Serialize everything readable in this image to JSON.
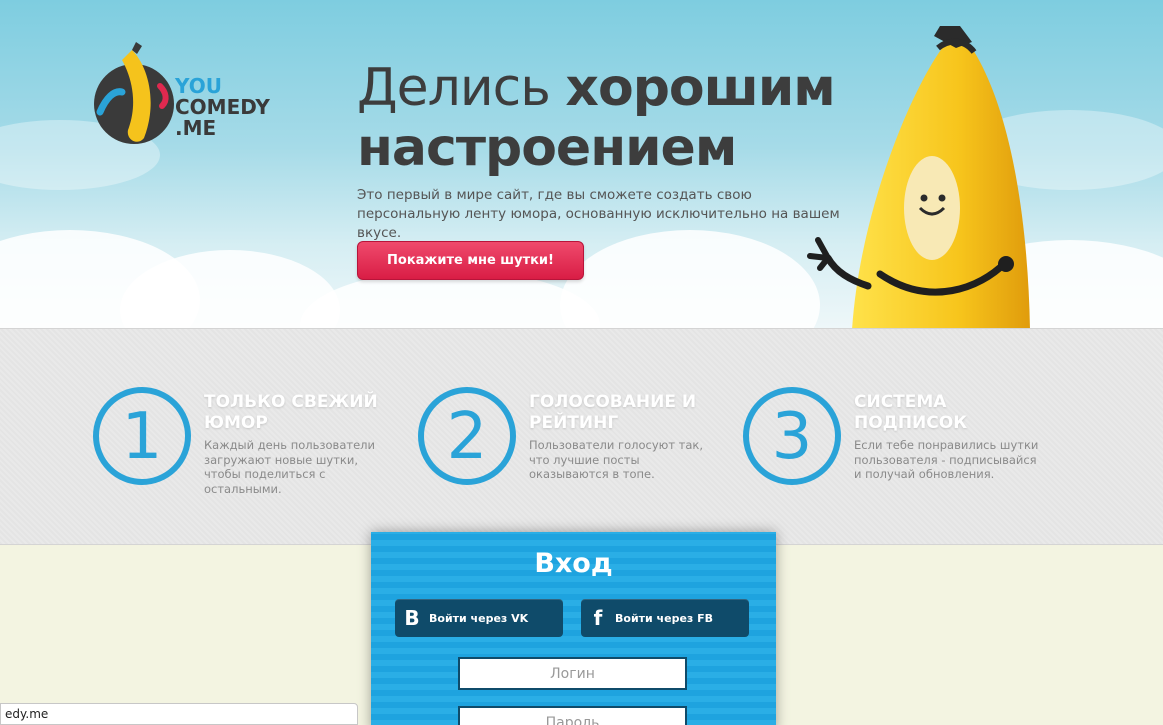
{
  "brand": {
    "line1": "YOU",
    "line2": "COMEDY",
    "line3": ".ME"
  },
  "hero": {
    "headline_light": "Делись ",
    "headline_bold_1": "хорошим",
    "headline_bold_2": "настроением",
    "subtext": "Это первый в мире сайт, где вы сможете создать свою персональную ленту юмора, основанную исключительно на вашем вкусе.",
    "cta_label": "Покажите мне шутки!"
  },
  "features": [
    {
      "number": "1",
      "title": "ТОЛЬКО СВЕЖИЙ ЮМОР",
      "desc": "Каждый день пользователи загружают новые шутки, чтобы поделиться с остальными."
    },
    {
      "number": "2",
      "title": "ГОЛОСОВАНИЕ И РЕЙТИНГ",
      "desc": "Пользователи голосуют так, что лучшие посты оказываются в топе."
    },
    {
      "number": "3",
      "title": "СИСТЕМА ПОДПИСОК",
      "desc": "Если тебе понравились шутки пользователя - подписывайся и получай обновления."
    }
  ],
  "login": {
    "title": "Вход",
    "vk_icon": "В",
    "vk_label": "Войти через VK",
    "fb_icon": "f",
    "fb_label": "Войти через FB",
    "login_placeholder": "Логин",
    "password_placeholder": "Пароль"
  },
  "status_bar": {
    "text": "edy.me"
  },
  "colors": {
    "accent_blue": "#2aa3d8",
    "cta_red": "#e0294f",
    "panel_blue": "#1ea3df",
    "dark_button": "#0f4b6a"
  }
}
